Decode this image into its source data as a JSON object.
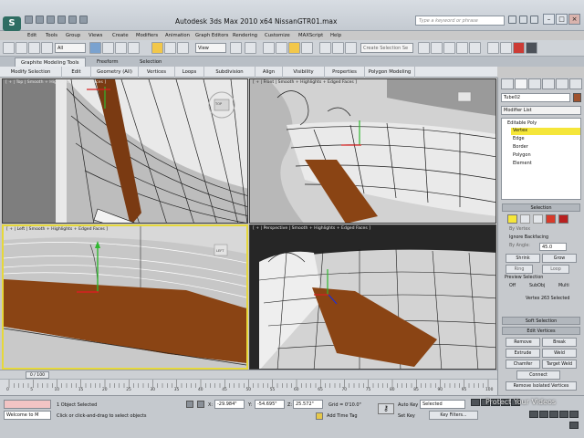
{
  "title_bar": {
    "title": "Autodesk 3ds Max  2010 x64     NissanGTR01.max",
    "search_placeholder": "Type a keyword or phrase",
    "logo_letter": "S"
  },
  "menu": [
    "Edit",
    "Tools",
    "Group",
    "Views",
    "Create",
    "Modifiers",
    "Animation",
    "Graph Editors",
    "Rendering",
    "Customize",
    "MAXScript",
    "Help"
  ],
  "toolbar": {
    "filter_value": "All",
    "reference_value": "View",
    "selection_set_placeholder": "Create Selection Se"
  },
  "ribbon": {
    "tabs": [
      "Graphite Modeling Tools",
      "Freeform",
      "Selection"
    ],
    "active_tab": "Graphite Modeling Tools",
    "panels": [
      "Modify Selection",
      "Edit",
      "Geometry (All)",
      "Vertices",
      "Loops",
      "Subdivision",
      "Align",
      "Visibility",
      "Properties",
      "Polygon Modeling"
    ]
  },
  "viewports": {
    "top_label": "[ + | Top | Smooth + Highlights + Edged Faces ]",
    "front_label": "[ + | Front | Smooth + Highlights + Edged Faces ]",
    "left_label": "[ + | Left | Smooth + Highlights + Edged Faces ]",
    "perspective_label": "[ + | Perspective | Smooth + Highlights + Edged Faces ]",
    "viewcube_left": "LEFT",
    "viewcube_top": "TOP"
  },
  "command_panel": {
    "object_name": "Tube02",
    "modifier_list_label": "Modifier List",
    "object_color": "#a0522d",
    "stack": {
      "root": "Editable Poly",
      "items": [
        "Vertex",
        "Edge",
        "Border",
        "Polygon",
        "Element"
      ],
      "selected": "Vertex"
    },
    "selection_header": "Selection",
    "by_vertex": "By Vertex",
    "ignore_backfacing": "Ignore Backfacing",
    "by_angle": "By Angle:",
    "by_angle_value": "45.0",
    "shrink": "Shrink",
    "grow": "Grow",
    "ring": "Ring",
    "loop": "Loop",
    "preview_selection": "Preview Selection",
    "preview_options": [
      "Off",
      "SubObj",
      "Multi"
    ],
    "preview_selected": "Off",
    "selected_status": "Vertex 263 Selected",
    "soft_selection": "Soft Selection",
    "edit_vertices": "Edit Vertices",
    "remove": "Remove",
    "break": "Break",
    "extrude": "Extrude",
    "weld": "Weld",
    "chamfer": "Chamfer",
    "target_weld": "Target Weld",
    "connect": "Connect",
    "remove_isolated": "Remove Isolated Vertices"
  },
  "timeline": {
    "frame_display": "0 / 100",
    "ticks": [
      "0",
      "5",
      "10",
      "15",
      "20",
      "25",
      "30",
      "35",
      "40",
      "45",
      "50",
      "55",
      "60",
      "65",
      "70",
      "75",
      "80",
      "85",
      "90",
      "95",
      "100"
    ]
  },
  "status": {
    "listener": "Welcome to M",
    "objects_selected": "1 Object Selected",
    "prompt": "Click or click-and-drag to select objects",
    "x_label": "X:",
    "x_value": "-29.984\"",
    "y_label": "Y:",
    "y_value": "-54.695\"",
    "z_label": "Z:",
    "z_value": "25.572\"",
    "grid": "Grid = 0'10.0\"",
    "add_time_tag": "Add Time Tag",
    "auto_key": "Auto Key",
    "selected_dropdown": "Selected",
    "set_key": "Set Key",
    "key_filters": "Key Filters...",
    "watermark": "Protect Your Videos"
  },
  "colors": {
    "accent_active_viewport": "#e6d83a",
    "selection_yellow": "#f5e63a",
    "brown_surface": "#8a4414",
    "gizmo_red": "#d82020",
    "gizmo_green": "#2fb82f",
    "gizmo_blue": "#1b2fd8"
  }
}
